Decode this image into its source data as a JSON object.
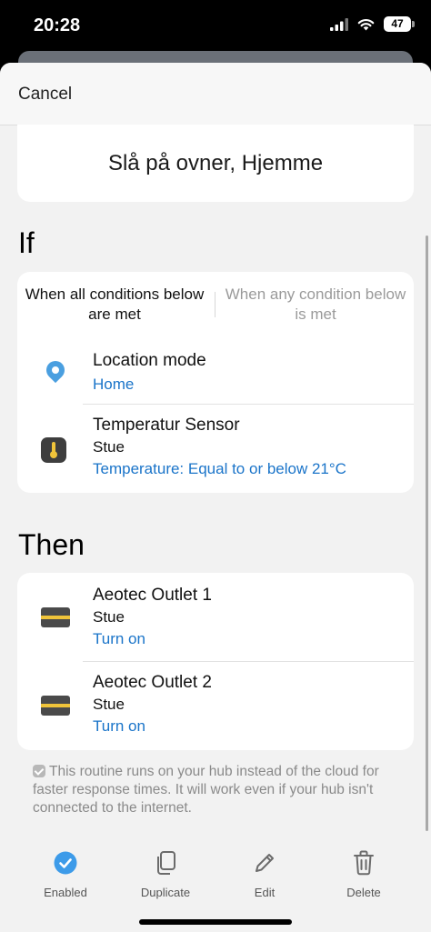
{
  "status_bar": {
    "time": "20:28",
    "battery": "47"
  },
  "header": {
    "cancel_label": "Cancel"
  },
  "routine": {
    "name": "Slå på ovner, Hjemme"
  },
  "if_section": {
    "heading": "If",
    "segment": {
      "all_label": "When all conditions below are met",
      "any_label": "When any condition below is met",
      "selected": "all"
    },
    "conditions": [
      {
        "icon": "location-pin-icon",
        "title": "Location mode",
        "subtitle": "",
        "detail": "Home"
      },
      {
        "icon": "thermometer-icon",
        "title": "Temperatur Sensor",
        "subtitle": "Stue",
        "detail": "Temperature: Equal to or below 21°C"
      }
    ]
  },
  "then_section": {
    "heading": "Then",
    "actions": [
      {
        "icon": "outlet-icon",
        "title": "Aeotec Outlet 1",
        "subtitle": "Stue",
        "detail": "Turn on"
      },
      {
        "icon": "outlet-icon",
        "title": "Aeotec Outlet 2",
        "subtitle": "Stue",
        "detail": "Turn on"
      }
    ]
  },
  "hub_note": "This routine runs on your hub instead of the cloud for faster response times. It will work even if your hub isn't connected to the internet.",
  "bottom_bar": {
    "enabled_label": "Enabled",
    "duplicate_label": "Duplicate",
    "edit_label": "Edit",
    "delete_label": "Delete"
  },
  "colors": {
    "link": "#1a74c9",
    "accent": "#3d9be9",
    "sensor_yellow": "#f0c43a"
  }
}
